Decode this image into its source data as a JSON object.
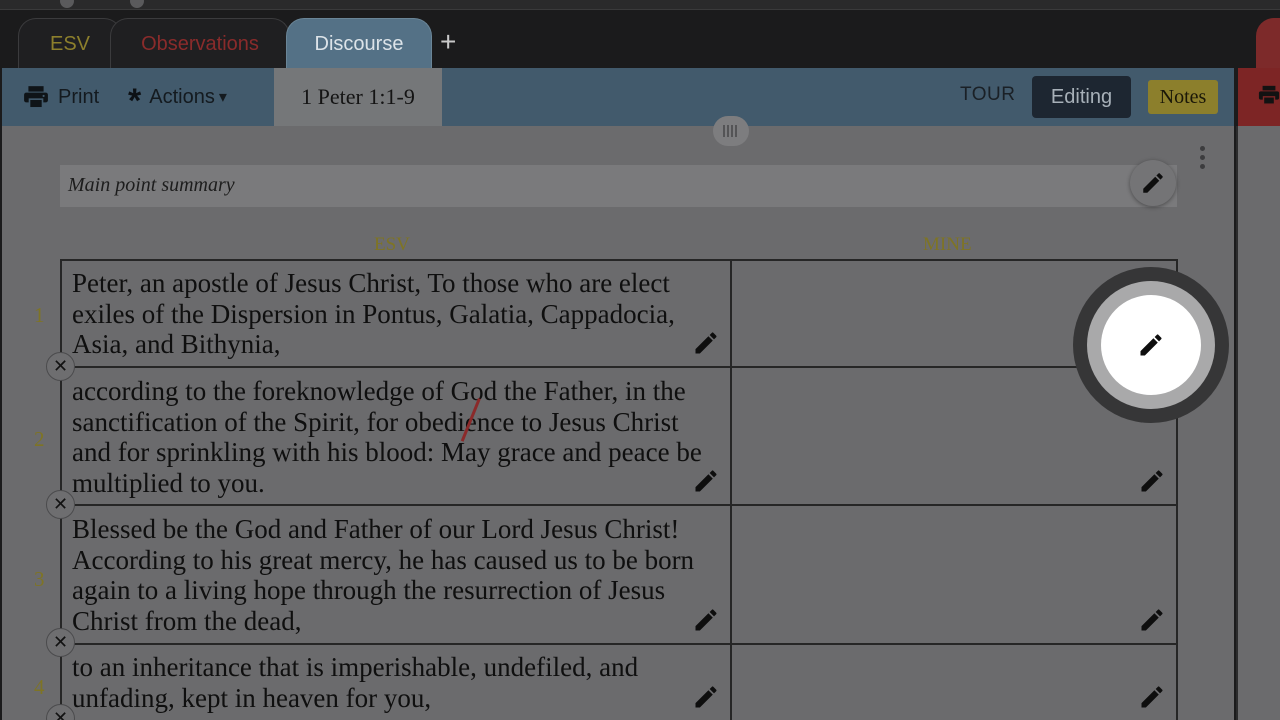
{
  "tabs": [
    {
      "label": "ESV"
    },
    {
      "label": "Observations"
    },
    {
      "label": "Discourse",
      "active": true
    }
  ],
  "add_tab_label": "+",
  "toolbar": {
    "print_label": "Print",
    "actions_label": "Actions",
    "actions_caret": "▾",
    "reference": "1 Peter 1:1-9",
    "tour_label": "TOUR",
    "editing_label": "Editing",
    "notes_label": "Notes"
  },
  "summary": {
    "placeholder": "Main point summary"
  },
  "columns": {
    "left": "ESV",
    "right": "MINE"
  },
  "verses": [
    {
      "num": "1",
      "text": "Peter, an apostle of Jesus Christ, To those who are elect exiles of the Dispersion in Pontus, Galatia, Cappadocia, Asia, and Bithynia,"
    },
    {
      "num": "2",
      "text": "according to the foreknowledge of God the Father, in the sanctification of the Spirit, for obedience to Jesus Christ and for sprinkling with his blood: May grace and peace be multiplied to you."
    },
    {
      "num": "3",
      "text": "Blessed be the God and Father of our Lord Jesus Christ! According to his great mercy, he has caused us to be born again to a living hope through the resurrection of Jesus Christ from the dead,"
    },
    {
      "num": "4",
      "text": "to an inheritance that is imperishable, undefiled, and unfading, kept in heaven for you,"
    }
  ],
  "icons": {
    "print": "printer-icon",
    "actions": "asterisk-icon",
    "edit": "pencil-icon",
    "remove": "close-icon",
    "menu": "kebab-icon",
    "grip": "drag-handle-icon"
  },
  "colors": {
    "esv_tab": "#8c7f2c",
    "observations_tab": "#8a2b2b",
    "discourse_tab": "#547186",
    "toolbar": "#425a6c",
    "notes_button": "#8c7f2c",
    "verse_number": "#7e7425"
  }
}
